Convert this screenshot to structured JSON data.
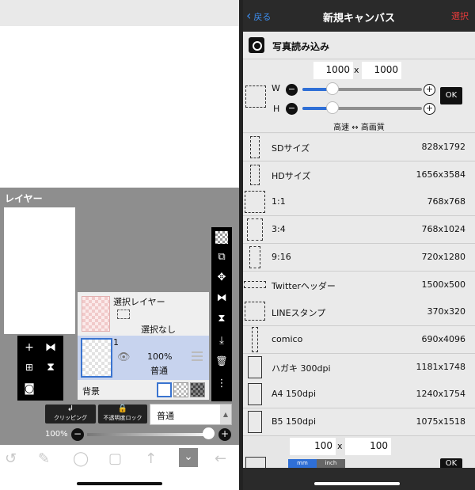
{
  "left": {
    "layer_panel_title": "レイヤー",
    "selection_layer": {
      "title": "選択レイヤー",
      "status": "選択なし"
    },
    "layer1": {
      "number": "1",
      "opacity": "100%",
      "blend": "普通"
    },
    "background_label": "背景",
    "clipping_label": "クリッピング",
    "lock_opacity_label": "不透明度ロック",
    "blend_mode_value": "普通",
    "opacity_pct_label": "100%",
    "opacity_fraction": 1.0,
    "icons": {
      "add": "+",
      "flip": "⧓",
      "add_frame": "⊞",
      "merge": "⧗",
      "camera": "◙",
      "move": "✥",
      "down": "⤓",
      "trash": "🗑",
      "more": "⋮",
      "tool_lasso": "↺",
      "tool_brush": "✎",
      "tool_circle": "◯",
      "tool_rect": "▢",
      "tool_up": "↑",
      "tool_collapse": "⌄",
      "tool_back": "←"
    }
  },
  "right": {
    "nav": {
      "back_label": "戻る",
      "title": "新規キャンバス",
      "select_label": "選択"
    },
    "photo_import_label": "写真読み込み",
    "custom": {
      "width": "1000",
      "height": "1000",
      "x": "x",
      "w_label": "W",
      "h_label": "H",
      "ok_label": "OK",
      "speed_label": "高速 ↔ 高画質"
    },
    "presets": [
      {
        "name": "SDサイズ",
        "size": "828x1792"
      },
      {
        "name": "HDサイズ",
        "size": "1656x3584"
      },
      {
        "name": "1:1",
        "size": "768x768"
      },
      {
        "name": "3:4",
        "size": "768x1024"
      },
      {
        "name": "9:16",
        "size": "720x1280"
      },
      {
        "name": "Twitterヘッダー",
        "size": "1500x500"
      },
      {
        "name": "LINEスタンプ",
        "size": "370x320"
      },
      {
        "name": "comico",
        "size": "690x4096"
      },
      {
        "name": "ハガキ 300dpi",
        "size": "1181x1748"
      },
      {
        "name": "A4 150dpi",
        "size": "1240x1754"
      },
      {
        "name": "B5 150dpi",
        "size": "1075x1518"
      }
    ],
    "extra": {
      "width": "100",
      "height": "100",
      "x": "x",
      "unit_mm": "mm",
      "unit_inch": "inch",
      "ok_label": "OK"
    }
  },
  "colors": {
    "accent_blue": "#3d8ef0",
    "select_red": "#e53a3a",
    "layer_highlight": "#c7d3ee"
  }
}
